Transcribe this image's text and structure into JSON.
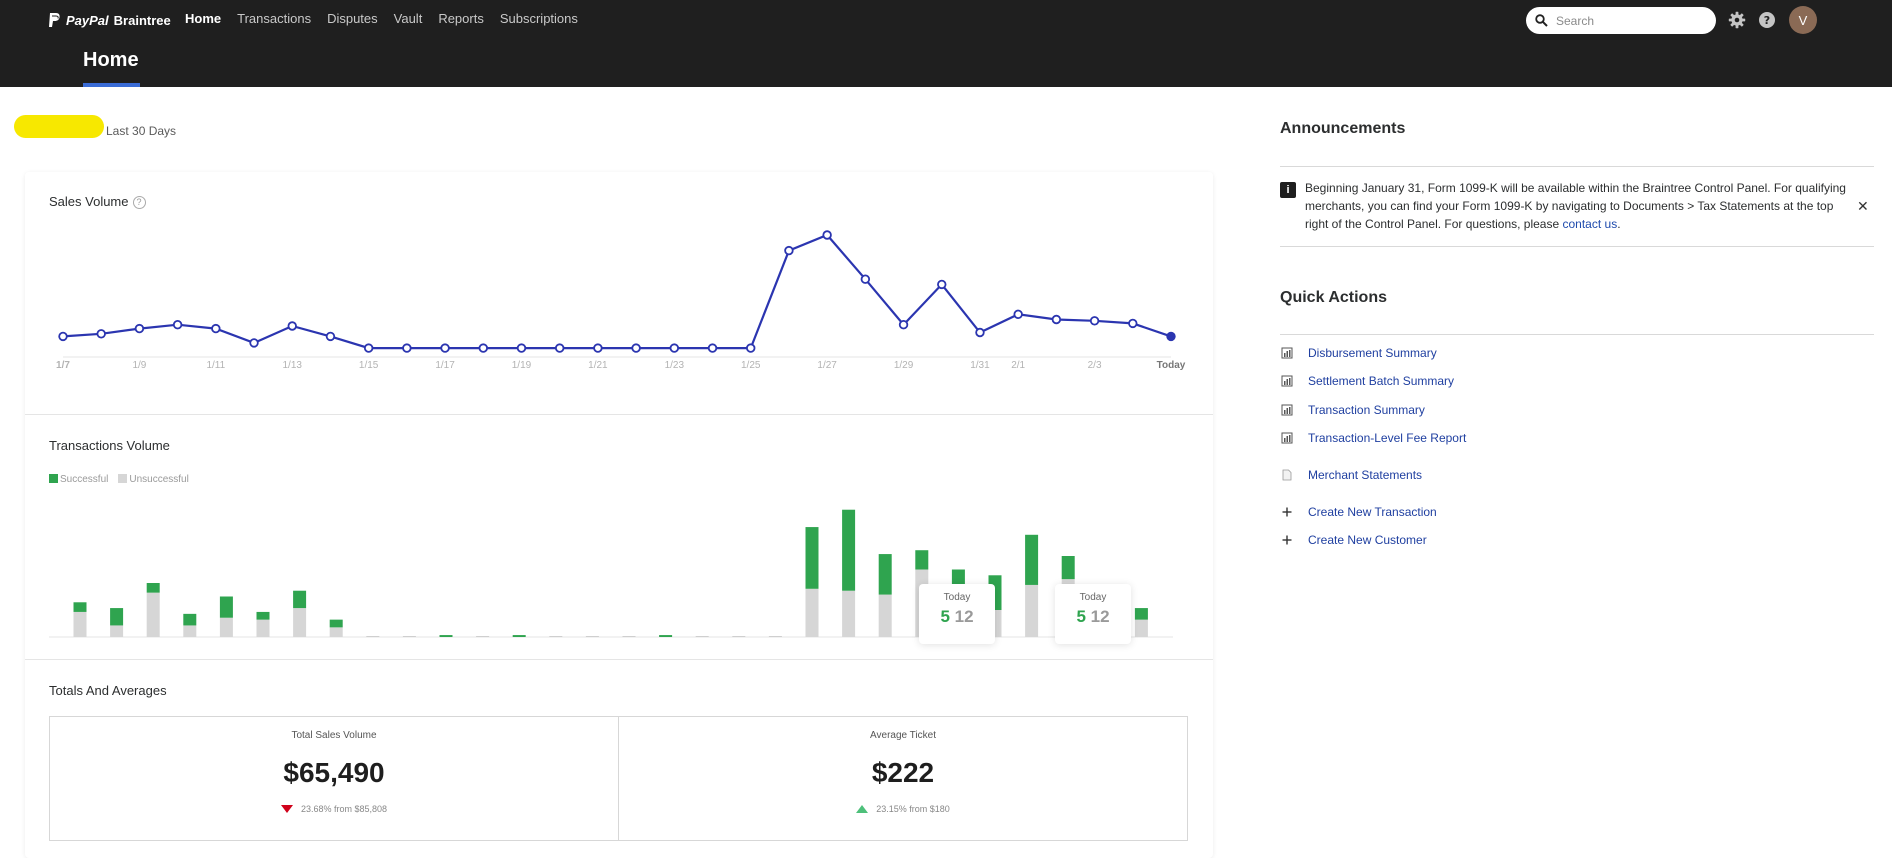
{
  "header": {
    "brand": "PayPal Braintree",
    "brand_left": "PayPal",
    "brand_right": "Braintree",
    "nav": [
      "Home",
      "Transactions",
      "Disputes",
      "Vault",
      "Reports",
      "Subscriptions"
    ],
    "active_nav": "Home",
    "search_placeholder": "Search",
    "avatar_initial": "V",
    "page_title": "Home",
    "icons": [
      "search-icon",
      "gear-icon",
      "help-icon"
    ]
  },
  "dashboard": {
    "period": "Last 30 Days",
    "sales_volume": {
      "title": "Sales Volume",
      "help": "?"
    },
    "transactions_volume": {
      "title": "Transactions Volume",
      "legend": [
        "Successful",
        "Unsuccessful"
      ],
      "tooltips": [
        {
          "label": "Today",
          "successful": "5",
          "total": "12"
        },
        {
          "label": "Today",
          "successful": "5",
          "total": "12"
        }
      ]
    },
    "totals": {
      "title": "Totals And Averages",
      "cells": [
        {
          "label": "Total Sales Volume",
          "value": "$65,490",
          "change": "23.68% from $85,808",
          "direction": "down"
        },
        {
          "label": "Average Ticket",
          "value": "$222",
          "change": "23.15% from $180",
          "direction": "up"
        }
      ]
    }
  },
  "chart_data": [
    {
      "type": "line",
      "title": "Sales Volume",
      "x_tick_labels": [
        "1/7",
        "1/9",
        "1/11",
        "1/13",
        "1/15",
        "1/17",
        "1/19",
        "1/21",
        "1/23",
        "1/25",
        "1/27",
        "1/29",
        "1/31",
        "2/1",
        "2/3",
        "Today"
      ],
      "series": [
        {
          "values": [
            12,
            14,
            18,
            21,
            18,
            7,
            20,
            12,
            3,
            3,
            3,
            3,
            3,
            3,
            3,
            3,
            3,
            3,
            3,
            78,
            90,
            56,
            21,
            52,
            15,
            29,
            25,
            24,
            22,
            12
          ]
        }
      ],
      "ylim": [
        0,
        100
      ],
      "colors": {
        "line": "#2b35b0"
      }
    },
    {
      "type": "bar",
      "title": "Transactions Volume",
      "legend": [
        "Successful",
        "Unsuccessful"
      ],
      "series": [
        {
          "name": "Successful",
          "values": [
            5,
            9,
            5,
            6,
            11,
            4,
            9,
            4,
            0,
            0,
            1,
            0,
            1,
            0,
            0,
            0,
            1,
            0,
            0,
            0,
            32,
            42,
            21,
            10,
            15,
            18,
            26,
            12,
            11,
            6
          ]
        },
        {
          "name": "Unsuccessful",
          "values": [
            13,
            6,
            23,
            6,
            10,
            9,
            15,
            5,
            0,
            0,
            0,
            0,
            0,
            0,
            0,
            0,
            0,
            0,
            0,
            0,
            25,
            24,
            22,
            35,
            20,
            14,
            27,
            30,
            8,
            9
          ]
        }
      ],
      "ylim": [
        0,
        70
      ],
      "colors": {
        "successful": "#2fa44f",
        "unsuccessful": "#d6d6d6"
      }
    }
  ],
  "announcements": {
    "title": "Announcements",
    "text": "Beginning January 31, Form 1099-K will be available within the Braintree Control Panel. For qualifying merchants, you can find your Form 1099-K by navigating to Documents > Tax Statements at the top right of the Control Panel. For questions, please",
    "link": "contact us",
    "tail": "."
  },
  "quick_actions": {
    "title": "Quick Actions",
    "items": [
      {
        "label": "Disbursement Summary",
        "icon": "report-icon"
      },
      {
        "label": "Settlement Batch Summary",
        "icon": "report-icon"
      },
      {
        "label": "Transaction Summary",
        "icon": "report-icon"
      },
      {
        "label": "Transaction-Level Fee Report",
        "icon": "report-icon"
      },
      {
        "label": "Merchant Statements",
        "icon": "document-icon"
      },
      {
        "label": "Create New Transaction",
        "icon": "plus-icon"
      },
      {
        "label": "Create New Customer",
        "icon": "plus-icon"
      }
    ]
  }
}
